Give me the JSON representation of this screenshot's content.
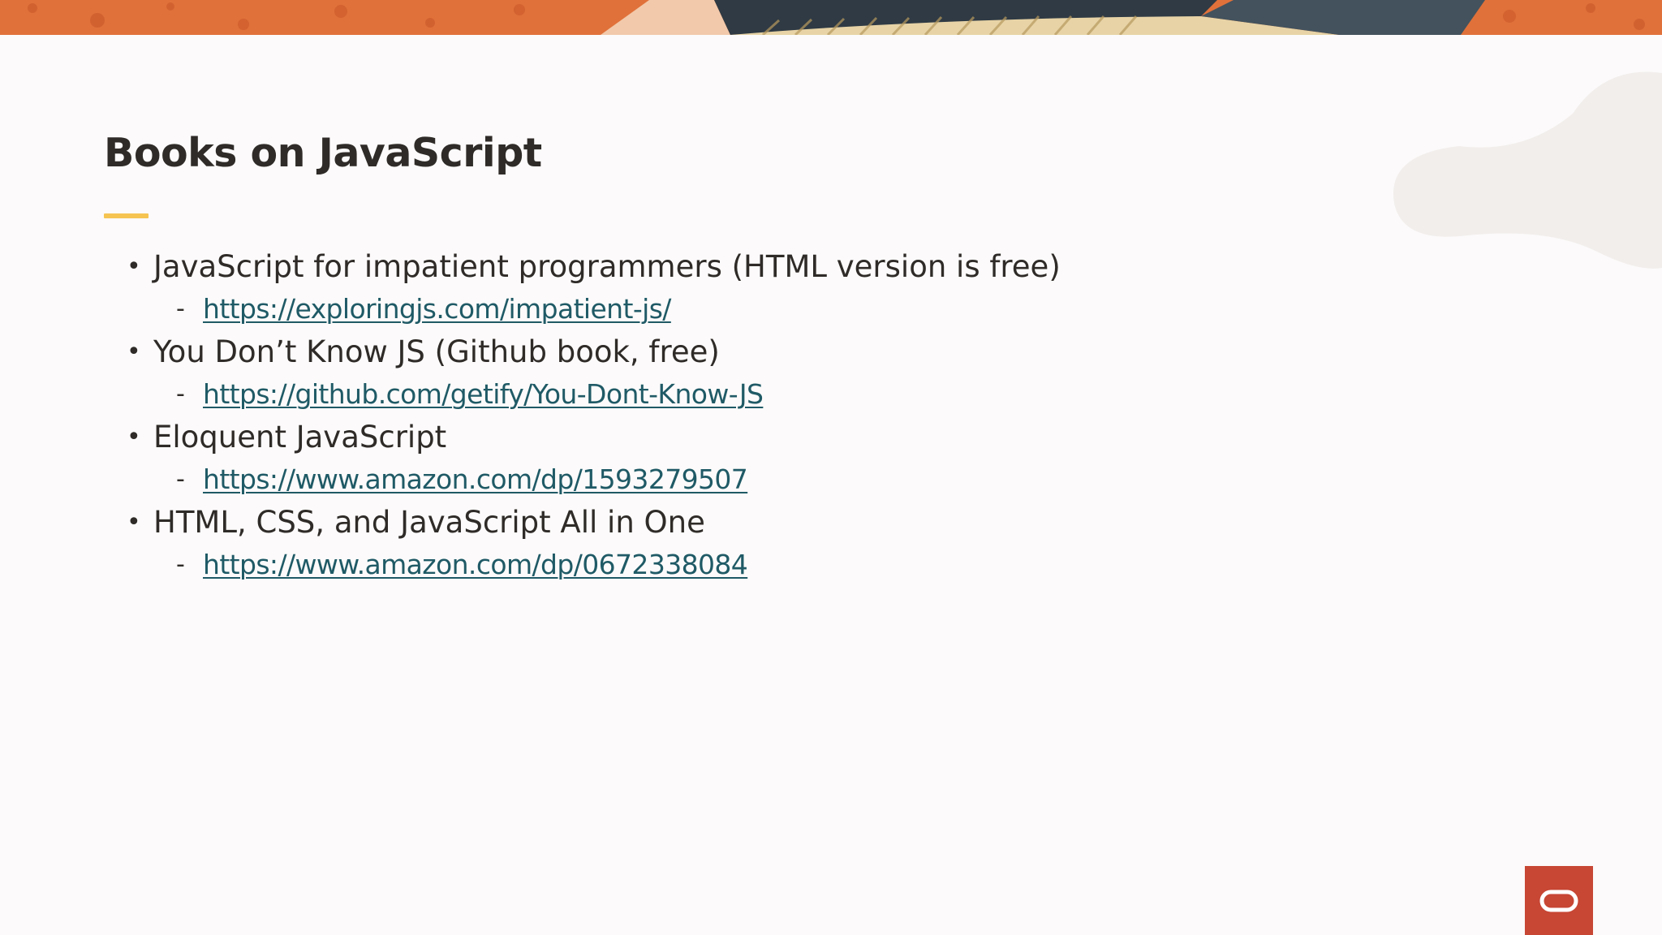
{
  "slide": {
    "title": "Books on JavaScript",
    "books": [
      {
        "title": "JavaScript for impatient programmers (HTML version is free)",
        "link": "https://exploringjs.com/impatient-js/"
      },
      {
        "title": "You Don’t Know JS (Github book, free)",
        "link": "https://github.com/getify/You-Dont-Know-JS"
      },
      {
        "title": "Eloquent JavaScript",
        "link": "https://www.amazon.com/dp/1593279507"
      },
      {
        "title": "HTML, CSS, and JavaScript All in One",
        "link": "https://www.amazon.com/dp/0672338084"
      }
    ]
  },
  "icons": {
    "bullet": "bullet-dot-icon",
    "dash": "dash-icon",
    "logo": "oracle-logo-icon"
  },
  "colors": {
    "accent_bar": "#f5c451",
    "link": "#1f5a66",
    "logo_bg": "#c74634",
    "banner_orange": "#e0713a"
  }
}
